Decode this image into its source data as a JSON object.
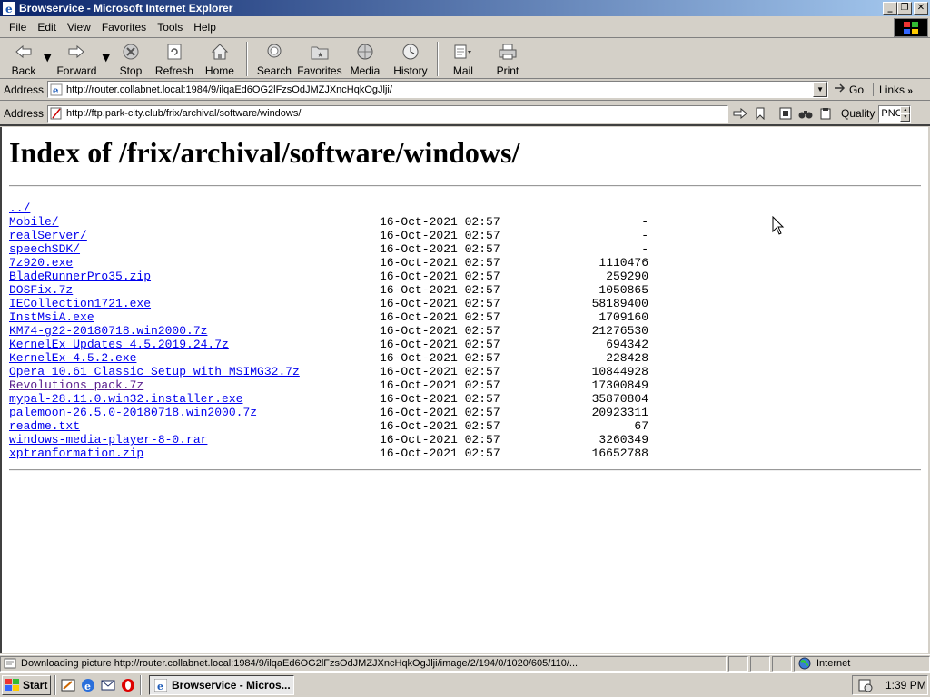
{
  "window": {
    "title": "Browservice - Microsoft Internet Explorer"
  },
  "menu": {
    "items": [
      {
        "label": "File"
      },
      {
        "label": "Edit"
      },
      {
        "label": "View"
      },
      {
        "label": "Favorites"
      },
      {
        "label": "Tools"
      },
      {
        "label": "Help"
      }
    ]
  },
  "toolbar": {
    "back": "Back",
    "forward": "Forward",
    "stop": "Stop",
    "refresh": "Refresh",
    "home": "Home",
    "search": "Search",
    "favorites": "Favorites",
    "media": "Media",
    "history": "History",
    "mail": "Mail",
    "print": "Print"
  },
  "ie_address": {
    "label": "Address",
    "url": "http://router.collabnet.local:1984/9/ilqaEd6OG2lFzsOdJMZJXncHqkOgJlji/",
    "go": "Go",
    "links": "Links"
  },
  "browservice_address": {
    "label": "Address",
    "url": "http://ftp.park-city.club/frix/archival/software/windows/",
    "quality_label": "Quality",
    "quality_value": "PNG"
  },
  "page": {
    "heading": "Index of /frix/archival/software/windows/",
    "entries": [
      {
        "name": "../",
        "date": "",
        "size": ""
      },
      {
        "name": "Mobile/",
        "date": "16-Oct-2021 02:57",
        "size": "-"
      },
      {
        "name": "realServer/",
        "date": "16-Oct-2021 02:57",
        "size": "-"
      },
      {
        "name": "speechSDK/",
        "date": "16-Oct-2021 02:57",
        "size": "-"
      },
      {
        "name": "7z920.exe",
        "date": "16-Oct-2021 02:57",
        "size": "1110476"
      },
      {
        "name": "BladeRunnerPro35.zip",
        "date": "16-Oct-2021 02:57",
        "size": "259290"
      },
      {
        "name": "DOSFix.7z",
        "date": "16-Oct-2021 02:57",
        "size": "1050865"
      },
      {
        "name": "IECollection1721.exe",
        "date": "16-Oct-2021 02:57",
        "size": "58189400"
      },
      {
        "name": "InstMsiA.exe",
        "date": "16-Oct-2021 02:57",
        "size": "1709160"
      },
      {
        "name": "KM74-g22-20180718.win2000.7z",
        "date": "16-Oct-2021 02:57",
        "size": "21276530"
      },
      {
        "name": "KernelEx Updates 4.5.2019.24.7z",
        "date": "16-Oct-2021 02:57",
        "size": "694342"
      },
      {
        "name": "KernelEx-4.5.2.exe",
        "date": "16-Oct-2021 02:57",
        "size": "228428"
      },
      {
        "name": "Opera_10.61_Classic_Setup_with_MSIMG32.7z",
        "date": "16-Oct-2021 02:57",
        "size": "10844928"
      },
      {
        "name": "Revolutions pack.7z",
        "date": "16-Oct-2021 02:57",
        "size": "17300849",
        "visited": true
      },
      {
        "name": "mypal-28.11.0.win32.installer.exe",
        "date": "16-Oct-2021 02:57",
        "size": "35870804"
      },
      {
        "name": "palemoon-26.5.0-20180718.win2000.7z",
        "date": "16-Oct-2021 02:57",
        "size": "20923311"
      },
      {
        "name": "readme.txt",
        "date": "16-Oct-2021 02:57",
        "size": "67"
      },
      {
        "name": "windows-media-player-8-0.rar",
        "date": "16-Oct-2021 02:57",
        "size": "3260349"
      },
      {
        "name": "xptranformation.zip",
        "date": "16-Oct-2021 02:57",
        "size": "16652788"
      }
    ]
  },
  "status": {
    "text": "Downloading picture http://router.collabnet.local:1984/9/ilqaEd6OG2lFzsOdJMZJXncHqkOgJlji/image/2/194/0/1020/605/110/...",
    "zone": "Internet"
  },
  "taskbar": {
    "start": "Start",
    "task_label": "Browservice - Micros...",
    "clock": "1:39 PM"
  },
  "colors": {
    "titlebar_start": "#0a246a",
    "titlebar_end": "#a6caf0",
    "link": "#0000ee",
    "visited_link": "#551a8b",
    "chrome": "#d4d0c8"
  }
}
